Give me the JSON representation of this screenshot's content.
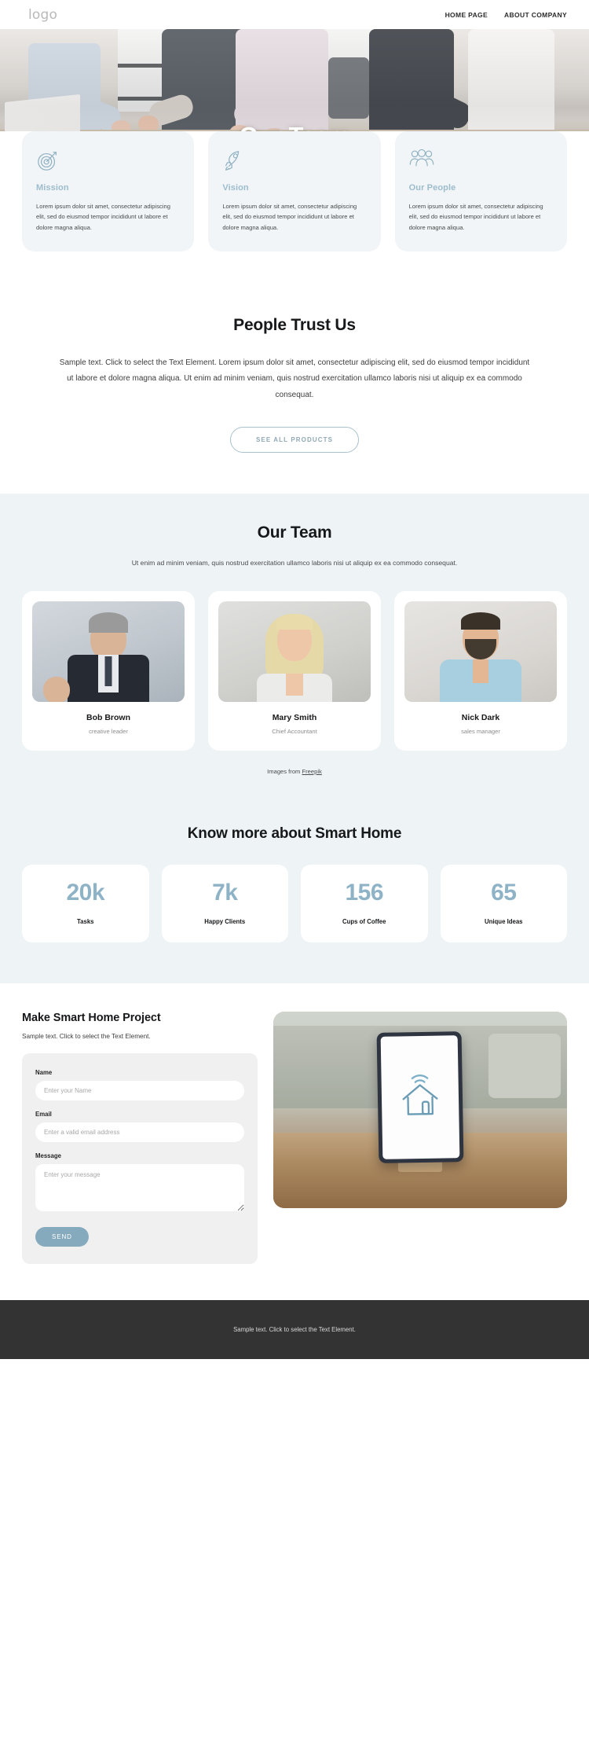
{
  "header": {
    "logo": "logo",
    "nav": [
      {
        "label": "HOME PAGE"
      },
      {
        "label": "ABOUT COMPANY"
      }
    ]
  },
  "hero": {
    "title": "Our Team"
  },
  "features": [
    {
      "icon": "target-icon",
      "title": "Mission",
      "text": "Lorem ipsum dolor sit amet, consectetur adipiscing elit, sed do eiusmod tempor incididunt ut labore et dolore magna aliqua."
    },
    {
      "icon": "rocket-icon",
      "title": "Vision",
      "text": "Lorem ipsum dolor sit amet, consectetur adipiscing elit, sed do eiusmod tempor incididunt ut labore et dolore magna aliqua."
    },
    {
      "icon": "people-group-icon",
      "title": "Our People",
      "text": "Lorem ipsum dolor sit amet, consectetur adipiscing elit, sed do eiusmod tempor incididunt ut labore et dolore magna aliqua."
    }
  ],
  "trust": {
    "heading": "People Trust Us",
    "paragraph": "Sample text. Click to select the Text Element. Lorem ipsum dolor sit amet, consectetur adipiscing elit, sed do eiusmod tempor incididunt ut labore et dolore magna aliqua. Ut enim ad minim veniam, quis nostrud exercitation ullamco laboris nisi ut aliquip ex ea commodo consequat.",
    "button": "SEE ALL PRODUCTS"
  },
  "team": {
    "heading": "Our Team",
    "subheading": "Ut enim ad minim veniam, quis nostrud exercitation ullamco laboris nisi ut aliquip ex ea commodo consequat.",
    "members": [
      {
        "name": "Bob Brown",
        "role": "creative leader"
      },
      {
        "name": "Mary Smith",
        "role": "Chief Accountant"
      },
      {
        "name": "Nick Dark",
        "role": "sales manager"
      }
    ],
    "credit_prefix": "Images from",
    "credit_link": "Freepik"
  },
  "stats": {
    "heading": "Know more about Smart Home",
    "items": [
      {
        "value": "20k",
        "label": "Tasks"
      },
      {
        "value": "7k",
        "label": "Happy Clients"
      },
      {
        "value": "156",
        "label": "Cups of Coffee"
      },
      {
        "value": "65",
        "label": "Unique Ideas"
      }
    ]
  },
  "contact": {
    "heading": "Make Smart Home Project",
    "subheading": "Sample text. Click to select the Text Element.",
    "fields": {
      "name_label": "Name",
      "name_placeholder": "Enter your Name",
      "email_label": "Email",
      "email_placeholder": "Enter a valid email address",
      "message_label": "Message",
      "message_placeholder": "Enter your message"
    },
    "submit": "SEND"
  },
  "footer": {
    "text": "Sample text. Click to select the Text Element."
  },
  "colors": {
    "accent": "#8fb3c6",
    "feature_bg": "#f1f5f8",
    "section_bg": "#eef3f6",
    "button_fill": "#86aabd",
    "footer_bg": "#333333"
  }
}
